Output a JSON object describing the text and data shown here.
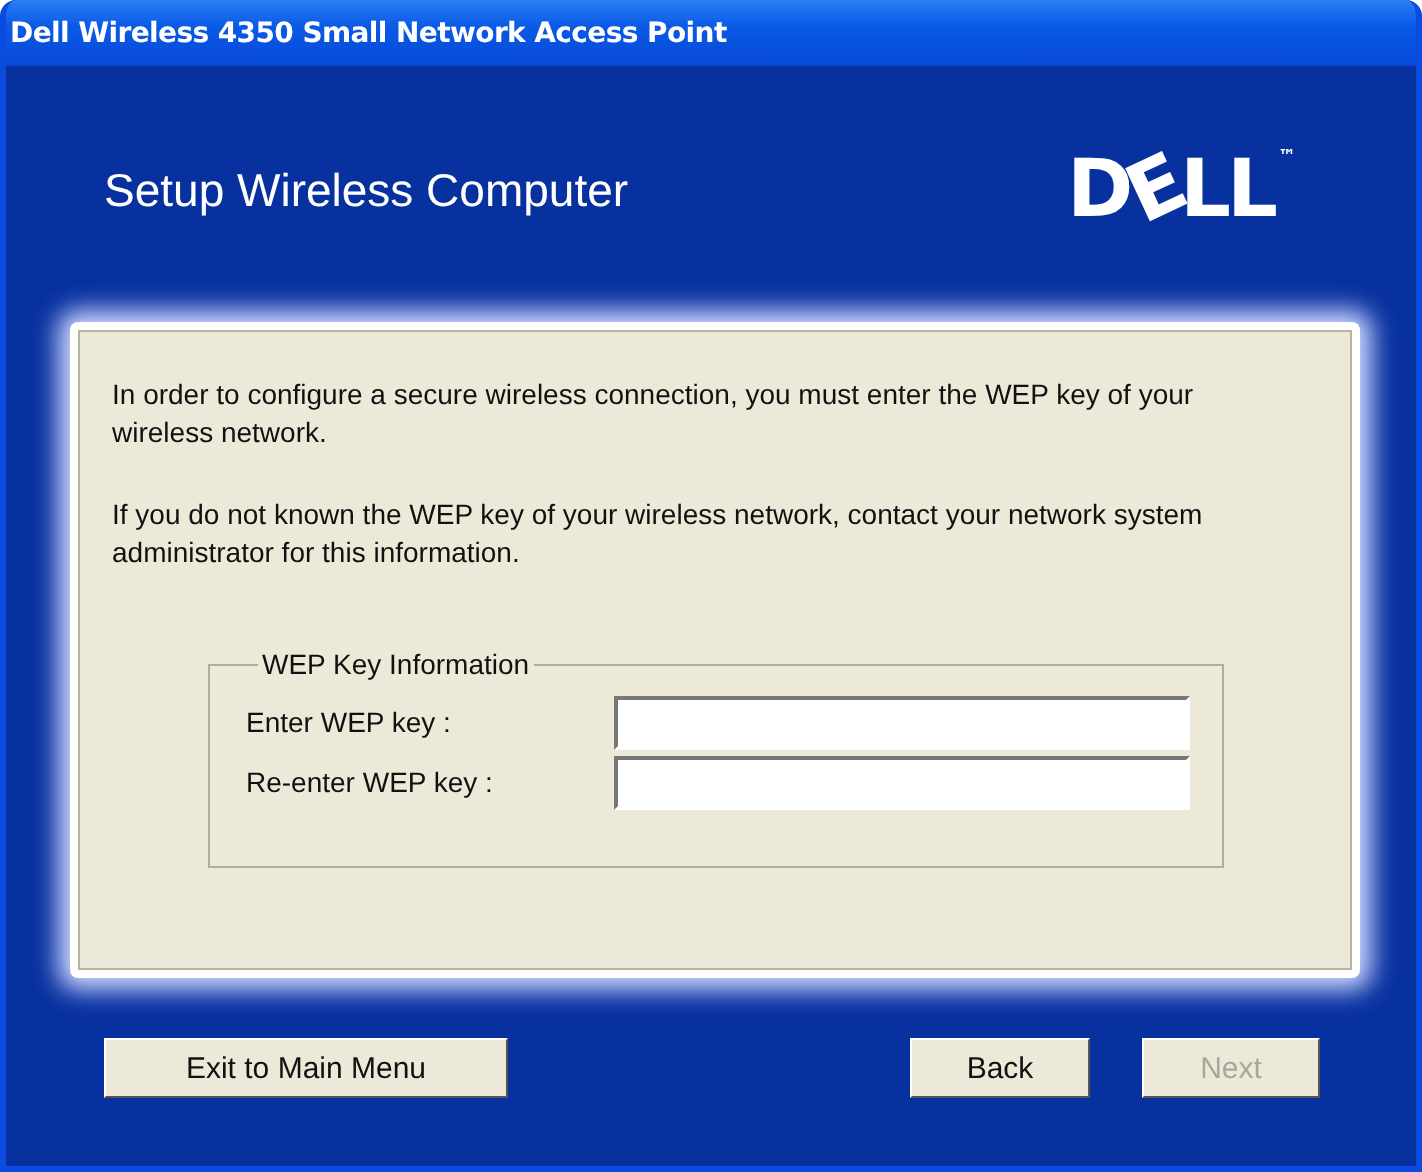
{
  "window": {
    "title": "Dell Wireless 4350 Small Network Access Point"
  },
  "header": {
    "title": "Setup Wireless Computer",
    "logo": "DELL",
    "logo_mark": "™"
  },
  "paragraphs": [
    "In order to configure a secure wireless connection, you must enter the WEP key of your wireless network.",
    "If you do not known the WEP key of your wireless network, contact your network system administrator for this information."
  ],
  "group": {
    "legend": "WEP Key Information",
    "fields": [
      {
        "label": "Enter WEP key :"
      },
      {
        "label": "Re-enter WEP key :"
      }
    ]
  },
  "buttons": [
    {
      "label": "Exit to Main Menu",
      "disabled": false
    },
    {
      "label": "Back",
      "disabled": false
    },
    {
      "label": "Next",
      "disabled": true
    }
  ]
}
